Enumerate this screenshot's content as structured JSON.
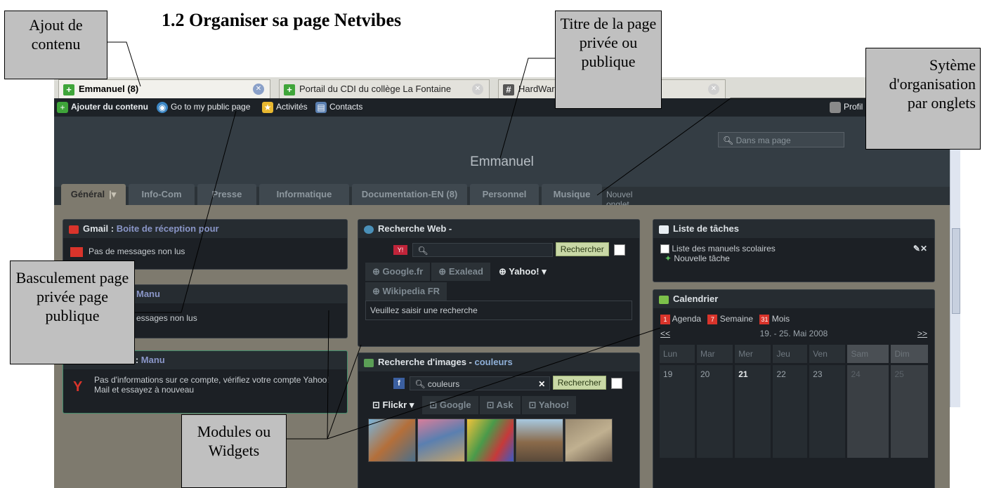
{
  "heading": "1.2 Organiser sa page Netvibes",
  "callouts": {
    "ajout": "Ajout de contenu",
    "titre": "Titre de la page privée ou publique",
    "onglets": "Sytème d'organisation par onglets",
    "bascule": "Basculement page privée page publique",
    "modules": "Modules ou Widgets"
  },
  "browser_tabs": [
    {
      "label": "Emmanuel (8)"
    },
    {
      "label": "Portail du CDI du collège La Fontaine"
    },
    {
      "label": "HardWare ..."
    }
  ],
  "toolbar": {
    "add_content": "Ajouter du contenu",
    "public_page": "Go to my public page",
    "activities": "Activités",
    "contacts": "Contacts",
    "profile": "Profil"
  },
  "header": {
    "search_placeholder": "Dans ma page",
    "page_title": "Emmanuel"
  },
  "page_tabs": [
    "Général",
    "Info-Com",
    "Presse",
    "Informatique",
    "Documentation-EN (8)",
    "Personnel",
    "Musique"
  ],
  "new_tab": "Nouvel onglet",
  "col1": {
    "gmail_title": "Gmail :",
    "gmail_sub": "Boite de réception pour",
    "gmail_msg": "Pas de messages non lus",
    "w2_sub": "Manu",
    "w2_msg": "essages non lus",
    "w3_title": "il :",
    "w3_sub": "Manu",
    "w3_msg": "Pas d'informations sur ce compte, vérifiez votre compte Yahoo! Mail et essayez à nouveau"
  },
  "col2": {
    "web_title": "Recherche Web -",
    "search_button": "Rechercher",
    "engines": [
      "Google.fr",
      "Exalead",
      "Yahoo!",
      "Wikipedia FR"
    ],
    "web_hint": "Veuillez saisir une recherche",
    "images_title": "Recherche d'images -",
    "images_sub": "couleurs",
    "images_query": "couleurs",
    "image_engines": [
      "Flickr",
      "Google",
      "Ask",
      "Yahoo!"
    ]
  },
  "col3": {
    "tasks_title": "Liste de tâches",
    "task1": "Liste des manuels scolaires",
    "new_task": "Nouvelle tâche",
    "cal_title": "Calendrier",
    "views": [
      "Agenda",
      "Semaine",
      "Mois"
    ],
    "view_icons": [
      "1",
      "7",
      "31"
    ],
    "prev": "<<",
    "next": ">>",
    "range": "19. - 25. Mai 2008",
    "days": [
      "Lun",
      "Mar",
      "Mer",
      "Jeu",
      "Ven",
      "Sam",
      "Dim"
    ],
    "dates": [
      "19",
      "20",
      "21",
      "22",
      "23",
      "24",
      "25"
    ]
  }
}
